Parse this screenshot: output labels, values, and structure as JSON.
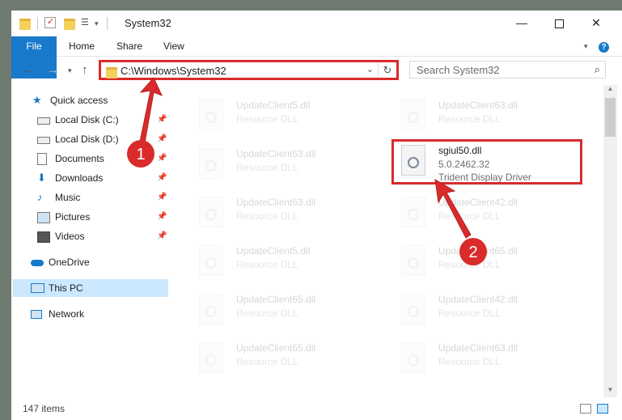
{
  "window": {
    "title": "System32",
    "min_icon": "minimize-icon",
    "max_icon": "maximize-icon",
    "close_icon": "close-icon"
  },
  "ribbon": {
    "tabs": [
      "File",
      "Home",
      "Share",
      "View"
    ],
    "help_icon": "help-icon",
    "collapse_icon": "chevron-down-icon"
  },
  "address": {
    "path": "C:\\Windows\\System32",
    "search_placeholder": "Search System32"
  },
  "nav": {
    "quick_access": "Quick access",
    "items": [
      {
        "label": "Local Disk (C:)",
        "icon": "drive-icon",
        "pinned": true
      },
      {
        "label": "Local Disk (D:)",
        "icon": "drive-icon",
        "pinned": true
      },
      {
        "label": "Documents",
        "icon": "documents-icon",
        "pinned": true
      },
      {
        "label": "Downloads",
        "icon": "download-icon",
        "pinned": true
      },
      {
        "label": "Music",
        "icon": "music-icon",
        "pinned": true
      },
      {
        "label": "Pictures",
        "icon": "pictures-icon",
        "pinned": true
      },
      {
        "label": "Videos",
        "icon": "videos-icon",
        "pinned": true
      }
    ],
    "onedrive": "OneDrive",
    "this_pc": "This PC",
    "network": "Network"
  },
  "files": {
    "left": [
      {
        "name": "UpdateClient5.dll",
        "desc": "Resource DLL"
      },
      {
        "name": "UpdateClient63.dll",
        "desc": "Resource DLL"
      },
      {
        "name": "UpdateClient63.dll",
        "desc": "Resource DLL"
      },
      {
        "name": "UpdateClient5.dll",
        "desc": "Resource DLL"
      },
      {
        "name": "UpdateClient65.dll",
        "desc": "Resource DLL"
      },
      {
        "name": "UpdateClient65.dll",
        "desc": "Resource DLL"
      }
    ],
    "right": [
      {
        "name": "UpdateClient63.dll",
        "desc": "Resource DLL"
      },
      {
        "name": "UpdateClient42.dll",
        "desc": "Resource DLL"
      },
      {
        "name": "UpdateClient65.dll",
        "desc": "Resource DLL"
      },
      {
        "name": "UpdateClient42.dll",
        "desc": "Resource DLL"
      },
      {
        "name": "UpdateClient63.dll",
        "desc": "Resource DLL"
      }
    ],
    "highlighted": {
      "name": "sgiul50.dll",
      "version": "5.0.2462.32",
      "desc": "Trident Display Driver"
    }
  },
  "status": {
    "count": "147 items"
  },
  "annotations": {
    "step1": "1",
    "step2": "2",
    "color": "#d92b2b"
  }
}
